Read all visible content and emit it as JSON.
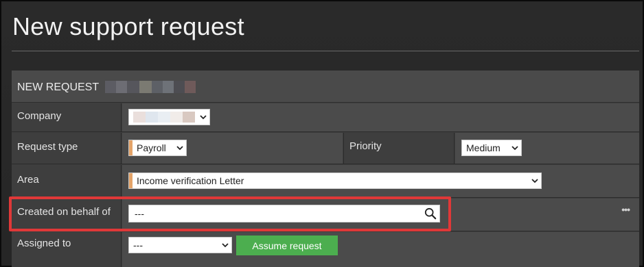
{
  "page": {
    "title": "New support request"
  },
  "panel": {
    "header_label": "NEW REQUEST"
  },
  "fields": {
    "company": {
      "label": "Company"
    },
    "request_type": {
      "label": "Request type",
      "value": "Payroll"
    },
    "priority": {
      "label": "Priority",
      "value": "Medium"
    },
    "area": {
      "label": "Area",
      "value": "Income verification Letter"
    },
    "created_on_behalf_of": {
      "label": "Created on behalf of",
      "value": "---"
    },
    "assigned_to": {
      "label": "Assigned to",
      "value": "---"
    }
  },
  "buttons": {
    "assume_request": "Assume request",
    "more": "•••"
  },
  "colors": {
    "required_marker": "#e4a469",
    "highlight": "#e03838",
    "action_button": "#4cae4f"
  },
  "icons": [
    "chevron-down-icon",
    "search-icon",
    "more-icon"
  ]
}
